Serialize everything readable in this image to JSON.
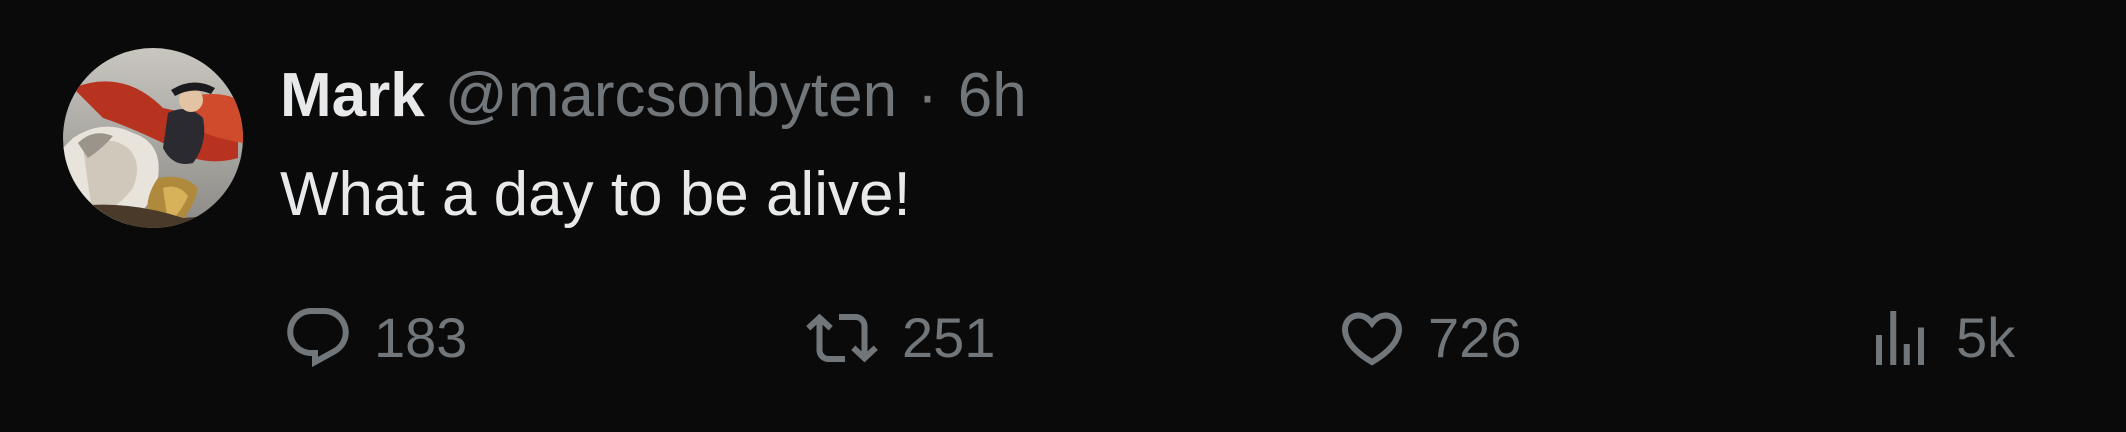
{
  "tweet": {
    "display_name": "Mark",
    "handle": "@marcsonbyten",
    "separator": "·",
    "time": "6h",
    "text": "What a day to be alive!",
    "avatar_icon": "avatar-painting-icon"
  },
  "actions": {
    "reply": {
      "icon": "reply-icon",
      "count": "183"
    },
    "retweet": {
      "icon": "retweet-icon",
      "count": "251"
    },
    "like": {
      "icon": "heart-icon",
      "count": "726"
    },
    "views": {
      "icon": "views-icon",
      "count": "5k"
    }
  },
  "colors": {
    "background": "#0a0a0a",
    "primary_text": "#e7e9ea",
    "secondary_text": "#71767b"
  }
}
